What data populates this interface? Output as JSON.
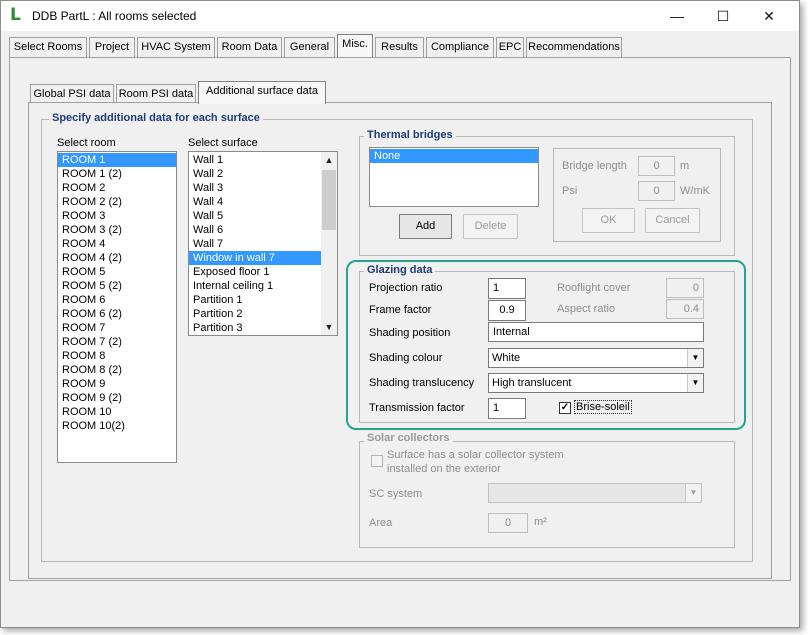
{
  "window": {
    "title": "DDB PartL : All rooms selected",
    "logo": "L",
    "minimize_glyph": "—",
    "maximize_glyph": "☐",
    "close_glyph": "✕",
    "icons": {
      "minimize": "minimize-icon",
      "maximize": "maximize-icon",
      "close": "close-icon",
      "logo": "app-logo-icon"
    }
  },
  "main_tabs": [
    "Select Rooms",
    "Project",
    "HVAC System",
    "Room Data",
    "General",
    "Misc.",
    "Results",
    "Compliance",
    "EPC",
    "Recommendations"
  ],
  "main_tab_active": "Misc.",
  "sub_tabs": [
    "Global PSI data",
    "Room PSI data",
    "Additional surface data"
  ],
  "sub_tab_active": "Additional surface data",
  "specify": {
    "title": "Specify additional data for each surface",
    "select_room_label": "Select room",
    "select_surface_label": "Select surface",
    "rooms": [
      "ROOM 1",
      "ROOM 1 (2)",
      "ROOM 2",
      "ROOM 2 (2)",
      "ROOM 3",
      "ROOM 3 (2)",
      "ROOM 4",
      "ROOM 4 (2)",
      "ROOM 5",
      "ROOM 5 (2)",
      "ROOM 6",
      "ROOM 6 (2)",
      "ROOM 7",
      "ROOM 7 (2)",
      "ROOM 8",
      "ROOM 8 (2)",
      "ROOM 9",
      "ROOM 9 (2)",
      "ROOM 10",
      "ROOM 10(2)"
    ],
    "selected_room": "ROOM 1",
    "surfaces": [
      "Wall  1",
      "Wall  2",
      "Wall  3",
      "Wall  4",
      "Wall  5",
      "Wall  6",
      "Wall  7",
      "Window in wall  7",
      "Exposed floor  1",
      "Internal ceiling  1",
      "Partition  1",
      "Partition  2",
      "Partition  3"
    ],
    "selected_surface": "Window in wall  7"
  },
  "thermal_bridges": {
    "title": "Thermal bridges",
    "items": [
      "None"
    ],
    "selected": "None",
    "add_label": "Add",
    "delete_label": "Delete",
    "bridge_length_label": "Bridge length",
    "bridge_length_value": "0",
    "bridge_length_unit": "m",
    "psi_label": "Psi",
    "psi_value": "0",
    "psi_unit": "W/mK",
    "ok_label": "OK",
    "cancel_label": "Cancel"
  },
  "glazing": {
    "title": "Glazing data",
    "projection_ratio_label": "Projection ratio",
    "projection_ratio_value": "1",
    "frame_factor_label": "Frame factor",
    "frame_factor_value": "0.9",
    "rooflight_cover_label": "Rooflight cover",
    "rooflight_cover_value": "0",
    "aspect_ratio_label": "Aspect ratio",
    "aspect_ratio_value": "0.4",
    "shading_position_label": "Shading position",
    "shading_position_value": "Internal",
    "shading_colour_label": "Shading colour",
    "shading_colour_value": "White",
    "shading_translucency_label": "Shading translucency",
    "shading_translucency_value": "High translucent",
    "transmission_factor_label": "Transmission factor",
    "transmission_factor_value": "1",
    "brise_soleil_label": "Brise-soleil",
    "brise_soleil_checked": true,
    "highlight_color": "#26a38a"
  },
  "solar": {
    "title": "Solar collectors",
    "checkbox_label_line1": "Surface has a solar collector system",
    "checkbox_label_line2": "installed on the exterior",
    "sc_system_label": "SC system",
    "sc_system_value": "",
    "area_label": "Area",
    "area_value": "0",
    "area_unit": "m²"
  },
  "colors": {
    "selection": "#3399ff",
    "group_title": "#1e3a78",
    "logo": "#2e8b2e"
  }
}
